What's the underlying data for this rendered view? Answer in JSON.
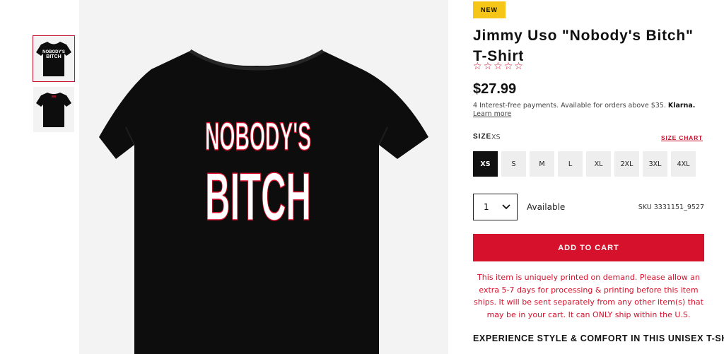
{
  "gallery": {
    "thumbnails": [
      {
        "name": "front",
        "graphic_text": [
          "NOBODY'S",
          "BITCH"
        ]
      },
      {
        "name": "back"
      }
    ],
    "main_graphic_text": [
      "NOBODY'S",
      "BITCH"
    ],
    "shirt_color": "#0d0d0d",
    "background_color": "#f3f3f3"
  },
  "product": {
    "badge": "NEW",
    "title": "Jimmy Uso \"Nobody's Bitch\" T-Shirt",
    "rating": {
      "value": 0,
      "max": 5,
      "star_glyph": "☆"
    },
    "price": "$27.99",
    "klarna": {
      "text": "4 Interest-free payments. Available for orders above $35.",
      "brand": "Klarna.",
      "link": "Learn more"
    },
    "size": {
      "label": "SIZE",
      "selected": "XS",
      "chart_link": "SIZE CHART",
      "options": [
        "XS",
        "S",
        "M",
        "L",
        "XL",
        "2XL",
        "3XL",
        "4XL"
      ]
    },
    "quantity": {
      "value": "1",
      "icon": "chevron-down-icon"
    },
    "availability": "Available",
    "sku": "SKU 3331151_9527",
    "add_to_cart": "ADD TO CART",
    "notice": "This item is uniquely printed on demand. Please allow an extra 5-7 days for processing & printing before this item ships. It will be sent separately from any other item(s) that may be in your cart. It can ONLY ship within the U.S.",
    "section_heading": "EXPERIENCE STYLE & COMFORT IN THIS UNISEX T-SHIRT"
  },
  "colors": {
    "accent_red": "#d6112b",
    "badge_yellow": "#f5c518",
    "star_red": "#c8102e"
  }
}
